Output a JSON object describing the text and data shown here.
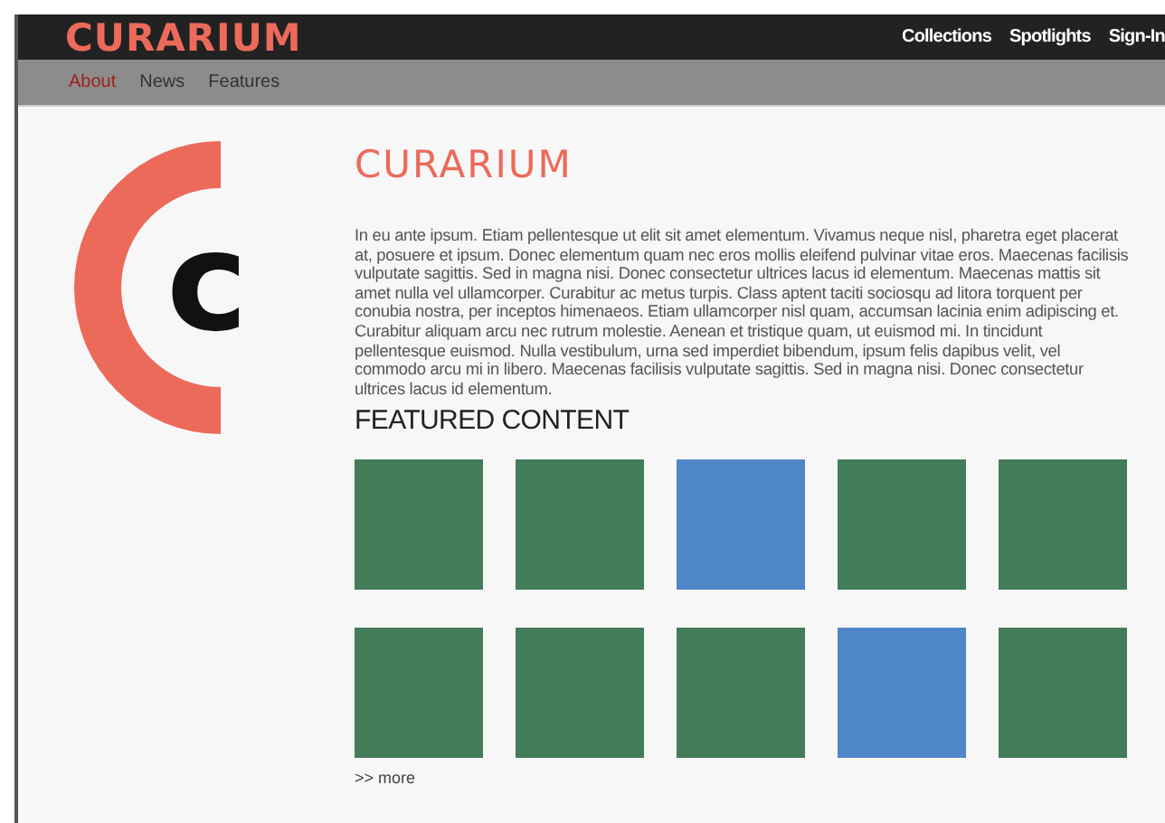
{
  "header": {
    "brand": "CURARIUM",
    "nav": [
      {
        "label": "Collections"
      },
      {
        "label": "Spotlights"
      },
      {
        "label": "Sign-In"
      }
    ]
  },
  "subnav": [
    {
      "label": "About",
      "selected": true
    },
    {
      "label": "News",
      "selected": false
    },
    {
      "label": "Features",
      "selected": false
    }
  ],
  "logo": {
    "letter": "c"
  },
  "main": {
    "title": "CURARIUM",
    "body": "In eu ante ipsum. Etiam pellentesque ut elit sit amet elementum. Vivamus neque nisl, pharetra eget placerat at, posuere et ipsum. Donec elementum quam nec eros mollis eleifend pulvinar vitae eros. Maecenas facilisis vulputate sagittis. Sed in magna nisi. Donec consectetur ultrices lacus id elementum. Maecenas mattis sit amet nulla vel ullamcorper. Curabitur ac metus turpis. Class aptent taciti sociosqu ad litora torquent per conubia nostra, per inceptos himenaeos. Etiam ullamcorper nisl quam, accumsan lacinia enim adipiscing et. Curabitur aliquam arcu nec rutrum molestie. Aenean et tristique quam, ut euismod mi. In tincidunt pellentesque euismod. Nulla vestibulum, urna sed imperdiet bibendum, ipsum felis dapibus velit, vel commodo arcu mi in libero. Maecenas facilisis vulputate sagittis. Sed in magna nisi. Donec consectetur ultrices lacus id elementum.",
    "featured_title": "FEATURED CONTENT",
    "tiles": [
      {
        "color": "#427c58"
      },
      {
        "color": "#427c58"
      },
      {
        "color": "#4e86c8"
      },
      {
        "color": "#427c58"
      },
      {
        "color": "#427c58"
      },
      {
        "color": "#427c58"
      },
      {
        "color": "#427c58"
      },
      {
        "color": "#427c58"
      },
      {
        "color": "#4e86c8"
      },
      {
        "color": "#427c58"
      }
    ],
    "more_link": ">> more"
  }
}
